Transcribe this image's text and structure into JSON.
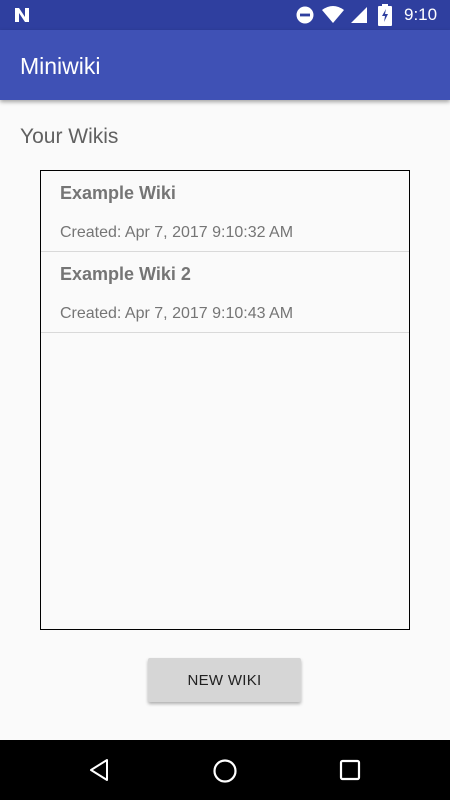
{
  "status_bar": {
    "time": "9:10",
    "icons": [
      "notification-n-icon",
      "do-not-disturb-icon",
      "wifi-icon",
      "signal-icon",
      "battery-charging-icon"
    ],
    "color": "#2f3f9f"
  },
  "app_bar": {
    "title": "Miniwiki",
    "color": "#3f51b5"
  },
  "section": {
    "title": "Your Wikis"
  },
  "wikis": [
    {
      "name": "Example Wiki",
      "created": "Created: Apr 7, 2017 9:10:32 AM"
    },
    {
      "name": "Example Wiki 2",
      "created": "Created: Apr 7, 2017 9:10:43 AM"
    }
  ],
  "actions": {
    "new_wiki_label": "NEW WIKI"
  },
  "nav_bar": {
    "icons": [
      "back-icon",
      "home-icon",
      "recents-icon"
    ]
  }
}
